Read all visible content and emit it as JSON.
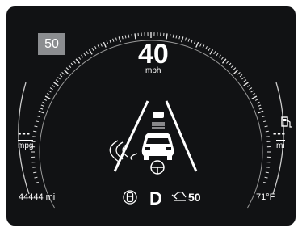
{
  "speed_limit_sign": "50",
  "speedometer": {
    "speed": "40",
    "unit": "mph"
  },
  "fuel_economy": {
    "value": "---",
    "unit": "mpg"
  },
  "range": {
    "value": "---",
    "unit": "mi"
  },
  "odometer": "44444 mi",
  "outside_temp": "71°F",
  "gear": "D",
  "cruise_set_speed": "50",
  "icons": [
    "speed-limit-sign",
    "fuel-pump-icon",
    "lane-keep-assist-icon",
    "steering-wheel-icon",
    "following-distance-icon",
    "cruise-control-icon"
  ],
  "colors": {
    "background": "#111214",
    "foreground": "#ffffff",
    "badge": "#8b8d90"
  }
}
